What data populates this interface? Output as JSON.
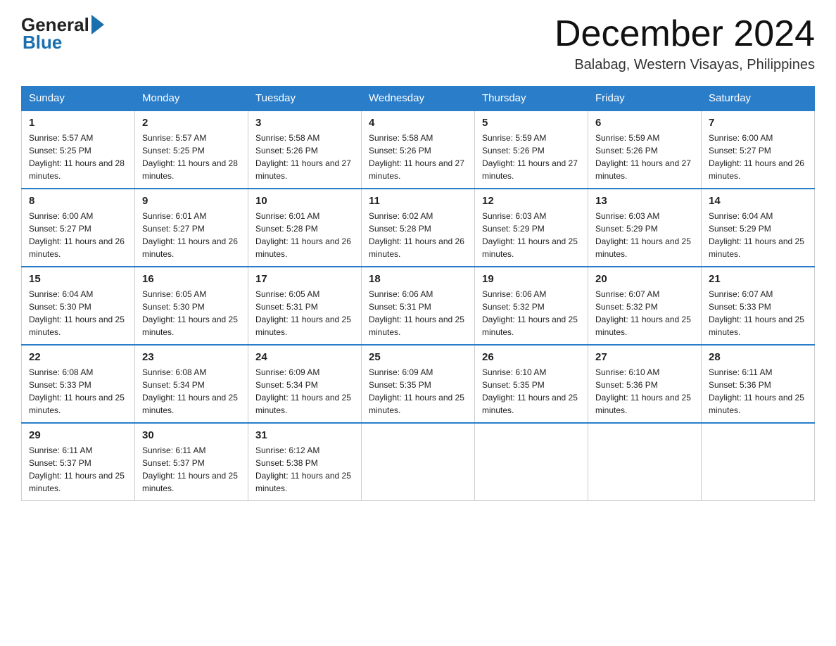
{
  "header": {
    "logo_general": "General",
    "logo_blue": "Blue",
    "month_year": "December 2024",
    "location": "Balabag, Western Visayas, Philippines"
  },
  "days_of_week": [
    "Sunday",
    "Monday",
    "Tuesday",
    "Wednesday",
    "Thursday",
    "Friday",
    "Saturday"
  ],
  "weeks": [
    [
      {
        "day": "1",
        "sunrise": "5:57 AM",
        "sunset": "5:25 PM",
        "daylight": "11 hours and 28 minutes."
      },
      {
        "day": "2",
        "sunrise": "5:57 AM",
        "sunset": "5:25 PM",
        "daylight": "11 hours and 28 minutes."
      },
      {
        "day": "3",
        "sunrise": "5:58 AM",
        "sunset": "5:26 PM",
        "daylight": "11 hours and 27 minutes."
      },
      {
        "day": "4",
        "sunrise": "5:58 AM",
        "sunset": "5:26 PM",
        "daylight": "11 hours and 27 minutes."
      },
      {
        "day": "5",
        "sunrise": "5:59 AM",
        "sunset": "5:26 PM",
        "daylight": "11 hours and 27 minutes."
      },
      {
        "day": "6",
        "sunrise": "5:59 AM",
        "sunset": "5:26 PM",
        "daylight": "11 hours and 27 minutes."
      },
      {
        "day": "7",
        "sunrise": "6:00 AM",
        "sunset": "5:27 PM",
        "daylight": "11 hours and 26 minutes."
      }
    ],
    [
      {
        "day": "8",
        "sunrise": "6:00 AM",
        "sunset": "5:27 PM",
        "daylight": "11 hours and 26 minutes."
      },
      {
        "day": "9",
        "sunrise": "6:01 AM",
        "sunset": "5:27 PM",
        "daylight": "11 hours and 26 minutes."
      },
      {
        "day": "10",
        "sunrise": "6:01 AM",
        "sunset": "5:28 PM",
        "daylight": "11 hours and 26 minutes."
      },
      {
        "day": "11",
        "sunrise": "6:02 AM",
        "sunset": "5:28 PM",
        "daylight": "11 hours and 26 minutes."
      },
      {
        "day": "12",
        "sunrise": "6:03 AM",
        "sunset": "5:29 PM",
        "daylight": "11 hours and 25 minutes."
      },
      {
        "day": "13",
        "sunrise": "6:03 AM",
        "sunset": "5:29 PM",
        "daylight": "11 hours and 25 minutes."
      },
      {
        "day": "14",
        "sunrise": "6:04 AM",
        "sunset": "5:29 PM",
        "daylight": "11 hours and 25 minutes."
      }
    ],
    [
      {
        "day": "15",
        "sunrise": "6:04 AM",
        "sunset": "5:30 PM",
        "daylight": "11 hours and 25 minutes."
      },
      {
        "day": "16",
        "sunrise": "6:05 AM",
        "sunset": "5:30 PM",
        "daylight": "11 hours and 25 minutes."
      },
      {
        "day": "17",
        "sunrise": "6:05 AM",
        "sunset": "5:31 PM",
        "daylight": "11 hours and 25 minutes."
      },
      {
        "day": "18",
        "sunrise": "6:06 AM",
        "sunset": "5:31 PM",
        "daylight": "11 hours and 25 minutes."
      },
      {
        "day": "19",
        "sunrise": "6:06 AM",
        "sunset": "5:32 PM",
        "daylight": "11 hours and 25 minutes."
      },
      {
        "day": "20",
        "sunrise": "6:07 AM",
        "sunset": "5:32 PM",
        "daylight": "11 hours and 25 minutes."
      },
      {
        "day": "21",
        "sunrise": "6:07 AM",
        "sunset": "5:33 PM",
        "daylight": "11 hours and 25 minutes."
      }
    ],
    [
      {
        "day": "22",
        "sunrise": "6:08 AM",
        "sunset": "5:33 PM",
        "daylight": "11 hours and 25 minutes."
      },
      {
        "day": "23",
        "sunrise": "6:08 AM",
        "sunset": "5:34 PM",
        "daylight": "11 hours and 25 minutes."
      },
      {
        "day": "24",
        "sunrise": "6:09 AM",
        "sunset": "5:34 PM",
        "daylight": "11 hours and 25 minutes."
      },
      {
        "day": "25",
        "sunrise": "6:09 AM",
        "sunset": "5:35 PM",
        "daylight": "11 hours and 25 minutes."
      },
      {
        "day": "26",
        "sunrise": "6:10 AM",
        "sunset": "5:35 PM",
        "daylight": "11 hours and 25 minutes."
      },
      {
        "day": "27",
        "sunrise": "6:10 AM",
        "sunset": "5:36 PM",
        "daylight": "11 hours and 25 minutes."
      },
      {
        "day": "28",
        "sunrise": "6:11 AM",
        "sunset": "5:36 PM",
        "daylight": "11 hours and 25 minutes."
      }
    ],
    [
      {
        "day": "29",
        "sunrise": "6:11 AM",
        "sunset": "5:37 PM",
        "daylight": "11 hours and 25 minutes."
      },
      {
        "day": "30",
        "sunrise": "6:11 AM",
        "sunset": "5:37 PM",
        "daylight": "11 hours and 25 minutes."
      },
      {
        "day": "31",
        "sunrise": "6:12 AM",
        "sunset": "5:38 PM",
        "daylight": "11 hours and 25 minutes."
      },
      null,
      null,
      null,
      null
    ]
  ]
}
